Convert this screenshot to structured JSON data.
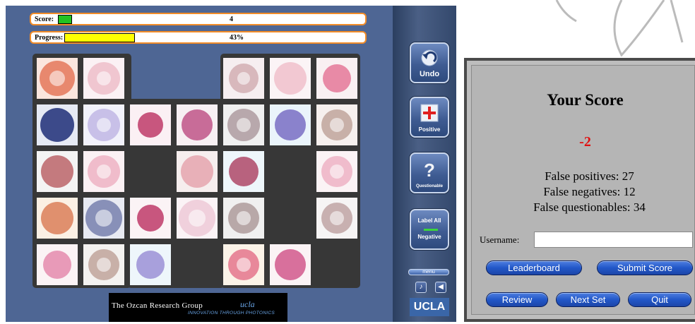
{
  "game": {
    "score_label": "Score:",
    "score_value": "4",
    "progress_label": "Progress:",
    "progress_value": "43%",
    "progress_fraction": 0.43
  },
  "toolbar": {
    "undo_label": "Undo",
    "positive_label": "Positive",
    "questionable_label": "Questionable",
    "label_all_line1": "Label All",
    "label_all_line2": "Negative",
    "menu_label": "menu",
    "ucla_label": "UCLA"
  },
  "logo": {
    "title": "The Ozcan Research Group",
    "ucla": "ucla",
    "tagline": "INNOVATION THROUGH PHOTONICS"
  },
  "score_panel": {
    "title": "Your Score",
    "value": "-2",
    "false_positives": "False positives: 27",
    "false_negatives": "False negatives: 12",
    "false_questionables": "False questionables: 34",
    "username_label": "Username:",
    "username_value": "",
    "buttons": {
      "leaderboard": "Leaderboard",
      "submit_score": "Submit Score",
      "review": "Review",
      "next_set": "Next Set",
      "quit": "Quit"
    }
  },
  "colors": {
    "game_bg": "#4e6694",
    "score_fill": "#22c322",
    "progress_fill": "#ffff00",
    "score_negative": "#e01010",
    "button_blue": "#2257c8"
  }
}
